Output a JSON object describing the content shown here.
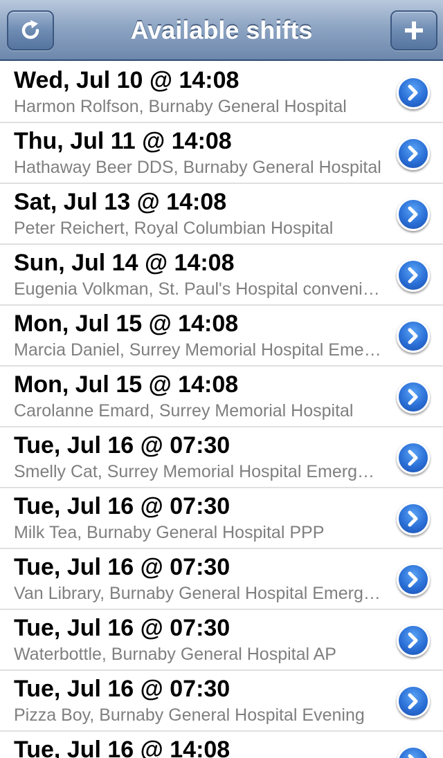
{
  "navbar": {
    "title": "Available shifts",
    "left_icon": "refresh-icon",
    "right_icon": "plus-icon"
  },
  "colors": {
    "navbar": "#8ea5c3",
    "accent": "#2a6fd6",
    "subtitle": "#7f7f7f"
  },
  "shifts": [
    {
      "title": "Wed, Jul 10 @ 14:08",
      "subtitle": "Harmon Rolfson, Burnaby General Hospital"
    },
    {
      "title": "Thu, Jul 11 @ 14:08",
      "subtitle": "Hathaway Beer DDS, Burnaby General Hospital"
    },
    {
      "title": "Sat, Jul 13 @ 14:08",
      "subtitle": "Peter Reichert, Royal Columbian Hospital"
    },
    {
      "title": "Sun, Jul 14 @ 14:08",
      "subtitle": "Eugenia Volkman, St. Paul's Hospital convenience"
    },
    {
      "title": "Mon, Jul 15 @ 14:08",
      "subtitle": "Marcia Daniel, Surrey Memorial Hospital Emergency"
    },
    {
      "title": "Mon, Jul 15 @ 14:08",
      "subtitle": "Carolanne Emard, Surrey Memorial Hospital"
    },
    {
      "title": "Tue, Jul 16 @ 07:30",
      "subtitle": "Smelly Cat, Surrey Memorial Hospital Emergency"
    },
    {
      "title": "Tue, Jul 16 @ 07:30",
      "subtitle": "Milk Tea, Burnaby General Hospital PPP"
    },
    {
      "title": "Tue, Jul 16 @ 07:30",
      "subtitle": "Van Library, Burnaby General Hospital Emergency"
    },
    {
      "title": "Tue, Jul 16 @ 07:30",
      "subtitle": "Waterbottle, Burnaby General Hospital AP"
    },
    {
      "title": "Tue, Jul 16 @ 07:30",
      "subtitle": "Pizza Boy, Burnaby General Hospital Evening"
    },
    {
      "title": "Tue, Jul 16 @ 14:08",
      "subtitle": ""
    }
  ]
}
